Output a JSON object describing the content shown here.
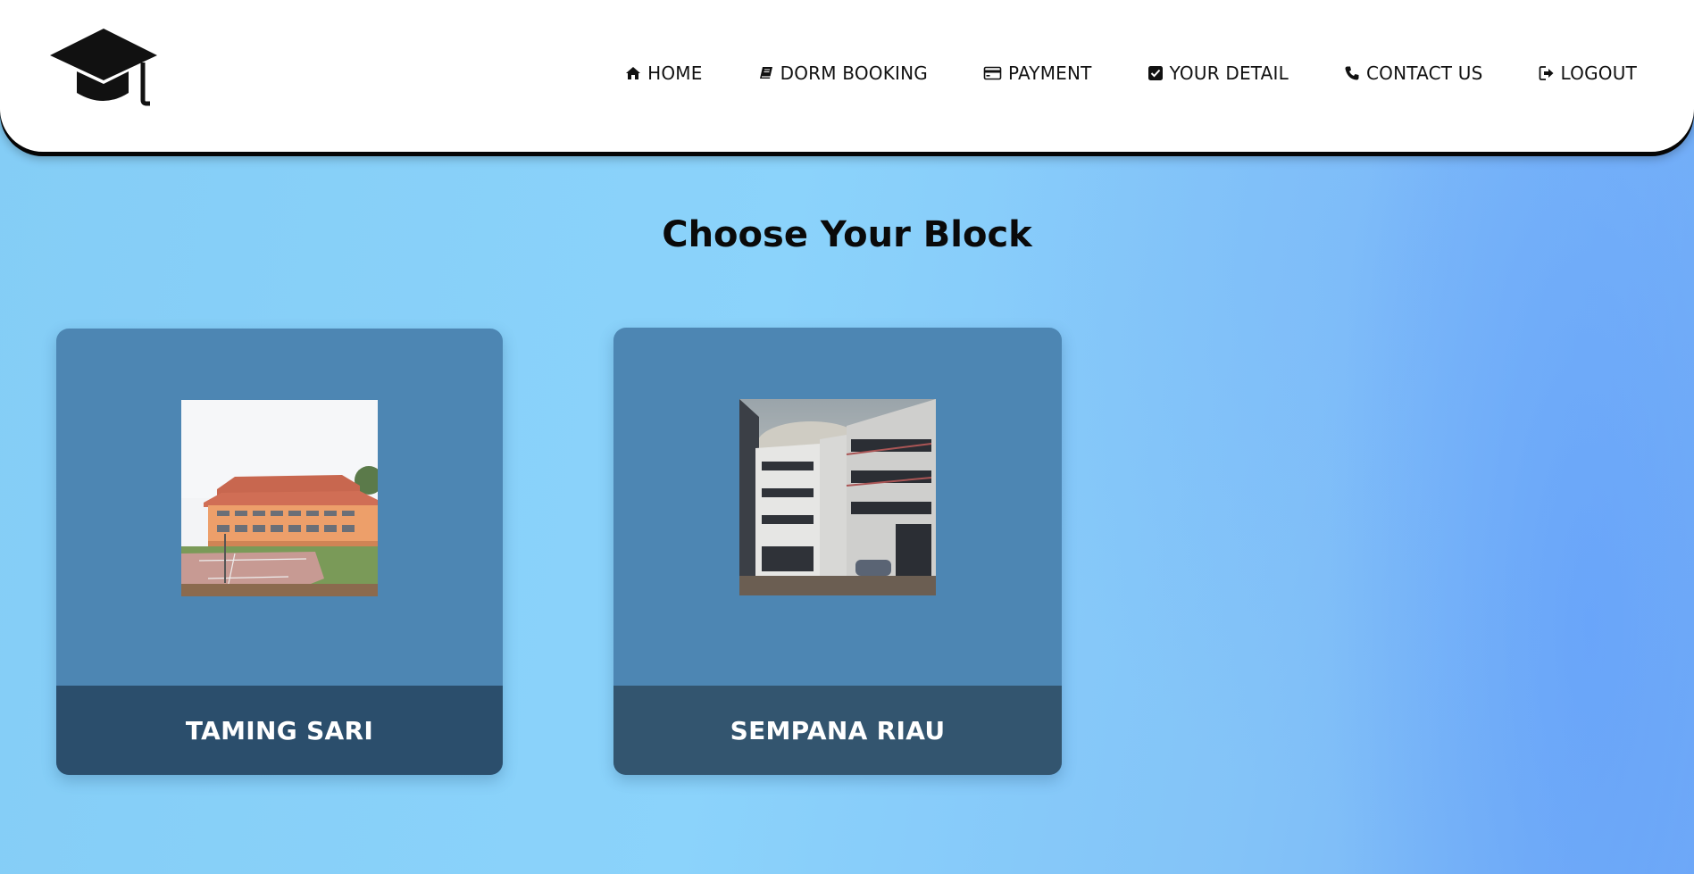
{
  "header": {
    "logo_icon": "graduation-cap-icon",
    "nav": [
      {
        "label": "HOME",
        "icon": "home-icon"
      },
      {
        "label": "DORM BOOKING",
        "icon": "book-icon"
      },
      {
        "label": "PAYMENT",
        "icon": "credit-card-icon"
      },
      {
        "label": "YOUR DETAIL",
        "icon": "check-square-icon"
      },
      {
        "label": "CONTACT US",
        "icon": "phone-icon"
      },
      {
        "label": "LOGOUT",
        "icon": "sign-out-icon"
      }
    ]
  },
  "main": {
    "title": "Choose Your Block",
    "blocks": [
      {
        "name": "TAMING SARI",
        "image": "orange-dormitory-building-photo"
      },
      {
        "name": "SEMPANA RIAU",
        "image": "grey-dormitory-building-photo"
      }
    ]
  },
  "colors": {
    "card_bg": "#4d86b3",
    "card_footer_1": "#2b4e6c",
    "card_footer_2": "#33556f",
    "header_bg": "#ffffff",
    "page_bg": "#88cff8"
  }
}
